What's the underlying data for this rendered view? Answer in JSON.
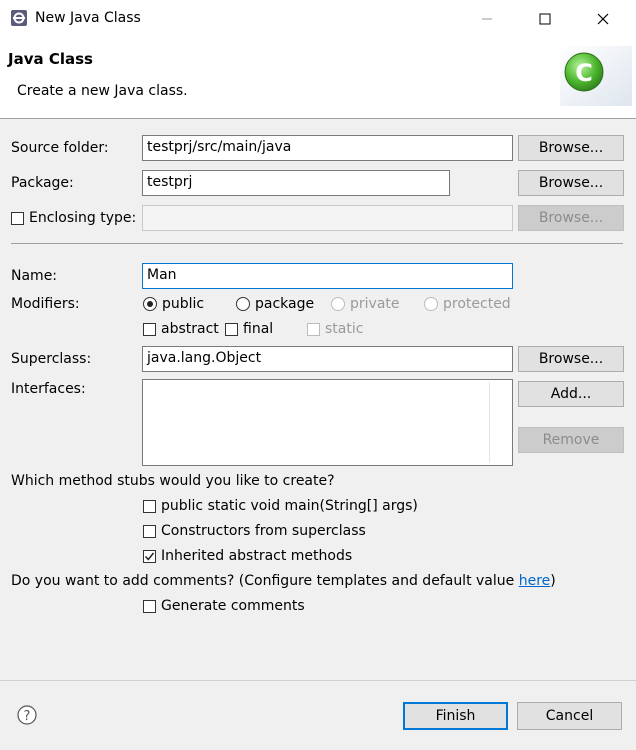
{
  "window": {
    "title": "New Java Class",
    "min_icon": "minimize-icon",
    "max_icon": "maximize-icon",
    "close_icon": "close-icon"
  },
  "header": {
    "title": "Java Class",
    "description": "Create a new Java class.",
    "logo_icon": "new-class-wizard-icon",
    "logo_letter": "C"
  },
  "form": {
    "source_folder": {
      "label": "Source folder:",
      "value": "testprj/src/main/java",
      "button": "Browse..."
    },
    "package": {
      "label": "Package:",
      "value": "testprj",
      "button": "Browse..."
    },
    "enclosing": {
      "label": "Enclosing type:",
      "value": "",
      "button": "Browse...",
      "checked": false
    },
    "name": {
      "label": "Name:",
      "value": "Man"
    },
    "modifiers": {
      "label": "Modifiers:",
      "access": [
        {
          "label": "public",
          "selected": true,
          "enabled": true
        },
        {
          "label": "package",
          "selected": false,
          "enabled": true
        },
        {
          "label": "private",
          "selected": false,
          "enabled": false
        },
        {
          "label": "protected",
          "selected": false,
          "enabled": false
        }
      ],
      "other": [
        {
          "label": "abstract",
          "checked": false,
          "enabled": true
        },
        {
          "label": "final",
          "checked": false,
          "enabled": true
        },
        {
          "label": "static",
          "checked": false,
          "enabled": false
        }
      ]
    },
    "superclass": {
      "label": "Superclass:",
      "value": "java.lang.Object",
      "button": "Browse..."
    },
    "interfaces": {
      "label": "Interfaces:",
      "add_button": "Add...",
      "remove_button": "Remove"
    },
    "stubs": {
      "question": "Which method stubs would you like to create?",
      "options": [
        {
          "label": "public static void main(String[] args)",
          "checked": false
        },
        {
          "label": "Constructors from superclass",
          "checked": false
        },
        {
          "label": "Inherited abstract methods",
          "checked": true
        }
      ]
    },
    "comments": {
      "question": "Do you want to add comments? (Configure templates and default value ",
      "link": "here",
      "question_end": ")",
      "option": {
        "label": "Generate comments",
        "checked": false
      }
    }
  },
  "footer": {
    "help_icon": "help-icon",
    "finish": "Finish",
    "cancel": "Cancel"
  }
}
